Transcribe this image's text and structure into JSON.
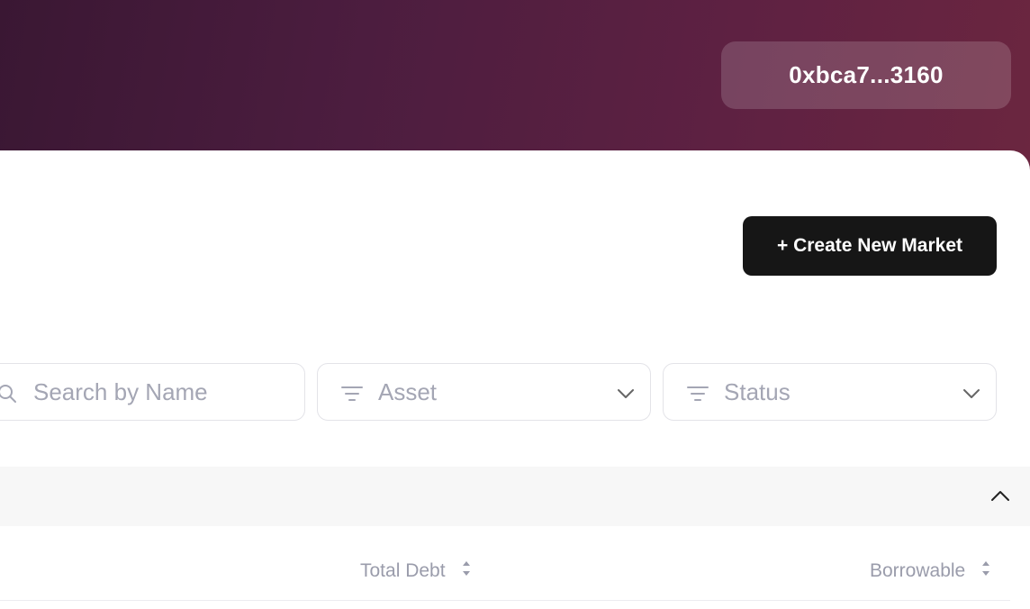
{
  "header": {
    "wallet_address": "0xbca7...3160",
    "gradient_colors": [
      "#3a1733",
      "#6b2640"
    ]
  },
  "toolbar": {
    "create_label": "+ Create New Market",
    "create_color": "#161616"
  },
  "filters": {
    "search_placeholder": "Search by Name",
    "asset_label": "Asset",
    "status_label": "Status"
  },
  "table": {
    "columns": [
      {
        "label": "Total Debt",
        "sortable": true
      },
      {
        "label": "Borrowable",
        "sortable": true
      }
    ]
  },
  "icons": {
    "search": "search-icon",
    "filter": "filter-icon",
    "chevron": "chevron-down-icon",
    "collapse": "chevron-up-icon",
    "sort": "sort-icon"
  }
}
